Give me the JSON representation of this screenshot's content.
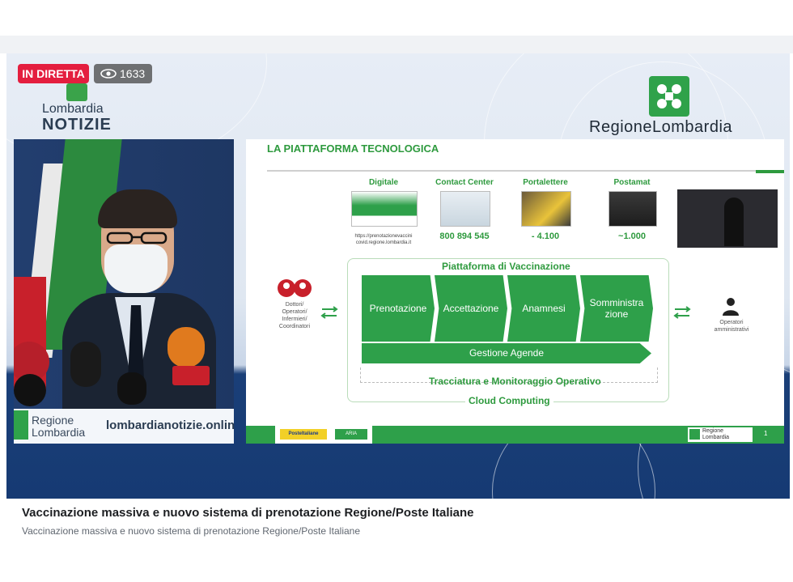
{
  "live": {
    "badge": "IN DIRETTA",
    "viewer_count": "1633"
  },
  "overlay": {
    "left_logo": {
      "line1": "Lombardia",
      "line2": "NOTIZIE"
    },
    "right_logo": "RegioneLombardia"
  },
  "speaker_footer": {
    "reg_line1": "Regione",
    "reg_line2": "Lombardia",
    "url": "lombardianotizie.onlin"
  },
  "slide": {
    "title": "LA PIATTAFORMA TECNOLOGICA",
    "channels": [
      {
        "label": "Digitale",
        "value": "",
        "url_line1": "https://prenotazionevaccini",
        "url_line2": "covid.regione.lombardia.it"
      },
      {
        "label": "Contact Center",
        "value": "800 894 545"
      },
      {
        "label": "Portalettere",
        "value": "- 4.100"
      },
      {
        "label": "Postamat",
        "value": "~1.000"
      }
    ],
    "platform_title": "Piattaforma di Vaccinazione",
    "steps": [
      "Prenotazione",
      "Accettazione",
      "Anamnesi",
      "Somministrazione"
    ],
    "step4_line1": "Somministra",
    "step4_line2": "zione",
    "agende": "Gestione Agende",
    "tracking": "Tracciatura e Monitoraggio Operativo",
    "cloud": "Cloud Computing",
    "left_group": [
      "Dottori/",
      "Operatori/",
      "Infermieri/",
      "Coordinatori"
    ],
    "right_group": [
      "Operatori",
      "amministrativi"
    ],
    "footer": {
      "poste": "PosteItaliane",
      "aria": "ARIA",
      "region_line1": "Regione",
      "region_line2": "Lombardia",
      "page": "1"
    }
  },
  "caption": {
    "title": "Vaccinazione massiva e nuovo sistema di prenotazione Regione/Poste Italiane",
    "subtitle": "Vaccinazione massiva e nuovo sistema di prenotazione Regione/Poste Italiane"
  },
  "colors": {
    "live_red": "#e41e3f",
    "region_green": "#2ea04a",
    "navy": "#163a73"
  }
}
